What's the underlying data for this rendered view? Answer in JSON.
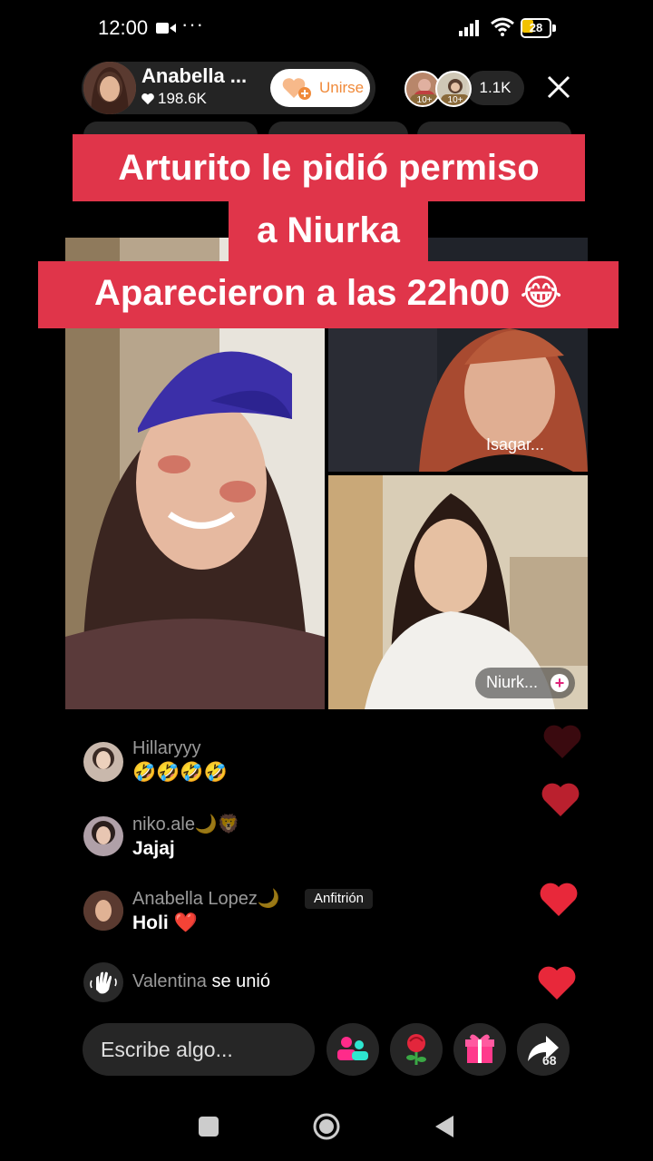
{
  "status_bar": {
    "time": "12:00",
    "dots": "···",
    "battery": "28"
  },
  "host": {
    "name": "Anabella ...",
    "likes": "198.6K",
    "join_label": "Unirse"
  },
  "viewers": {
    "badge": "10+",
    "count": "1.1K"
  },
  "caption": {
    "line1": "Arturito le pidió permiso",
    "line2": "a Niurka",
    "line3": "Aparecieron a las 22h00 😂"
  },
  "guests": [
    {
      "label": "Isagar..."
    },
    {
      "label": "Niurk..."
    }
  ],
  "chat": [
    {
      "user": "Hillaryyy",
      "message": "🤣🤣🤣🤣"
    },
    {
      "user": "niko.ale🌙🦁",
      "message": "Jajaj"
    },
    {
      "user": "Anabella Lopez🌙",
      "tag": "Anfitrión",
      "message": "Holi ❤️"
    }
  ],
  "join_event": {
    "user": "Valentina",
    "text": "se unió"
  },
  "bottom_bar": {
    "input_placeholder": "Escribe algo...",
    "share_count": "68"
  },
  "colors": {
    "caption_bg": "#e0354a",
    "heart": "#e8283a",
    "join_orange": "#f08a3a"
  }
}
